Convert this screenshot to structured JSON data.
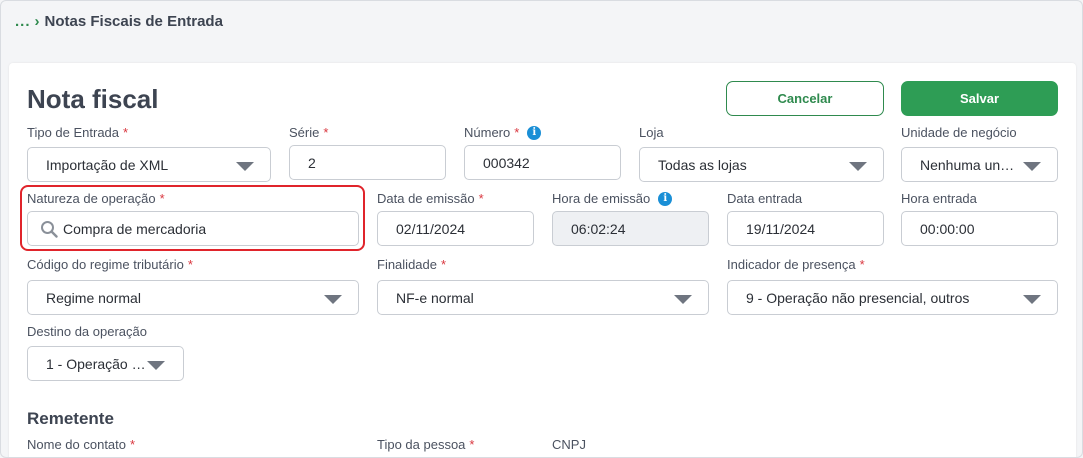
{
  "breadcrumb": {
    "ellipsis": "...",
    "chevron": "›",
    "current": "Notas Fiscais de Entrada"
  },
  "page": {
    "title": "Nota fiscal"
  },
  "actions": {
    "cancel": "Cancelar",
    "save": "Salvar"
  },
  "colors": {
    "accent": "#2e9d55",
    "required": "#d9363e",
    "highlight": "#e0242b",
    "info": "#1a8fd6"
  },
  "form": {
    "tipo_entrada": {
      "label": "Tipo de Entrada",
      "required": "*",
      "value": "Importação de XML"
    },
    "serie": {
      "label": "Série",
      "required": "*",
      "value": "2"
    },
    "numero": {
      "label": "Número",
      "required": "*",
      "info_icon": "i",
      "value": "000342"
    },
    "loja": {
      "label": "Loja",
      "value": "Todas as lojas"
    },
    "unidade": {
      "label": "Unidade de negócio",
      "value": "Nenhuma uni…"
    },
    "natureza": {
      "label": "Natureza de operação",
      "required": "*",
      "value": "Compra de mercadoria"
    },
    "data_emissao": {
      "label": "Data de emissão",
      "required": "*",
      "value": "02/11/2024"
    },
    "hora_emissao": {
      "label": "Hora de emissão",
      "info_icon": "i",
      "value": "06:02:24"
    },
    "data_entrada": {
      "label": "Data entrada",
      "value": "19/11/2024"
    },
    "hora_entrada": {
      "label": "Hora entrada",
      "value": "00:00:00"
    },
    "regime": {
      "label": "Código do regime tributário",
      "required": "*",
      "value": "Regime normal"
    },
    "finalidade": {
      "label": "Finalidade",
      "required": "*",
      "value": "NF-e normal"
    },
    "presenca": {
      "label": "Indicador de presença",
      "required": "*",
      "value": "9 - Operação não presencial, outros"
    },
    "destino": {
      "label": "Destino da operação",
      "value": "1 - Operação …"
    }
  },
  "remetente": {
    "title": "Remetente",
    "nome_contato": {
      "label": "Nome do contato",
      "required": "*"
    },
    "tipo_pessoa": {
      "label": "Tipo da pessoa",
      "required": "*"
    },
    "cnpj": {
      "label": "CNPJ"
    }
  }
}
